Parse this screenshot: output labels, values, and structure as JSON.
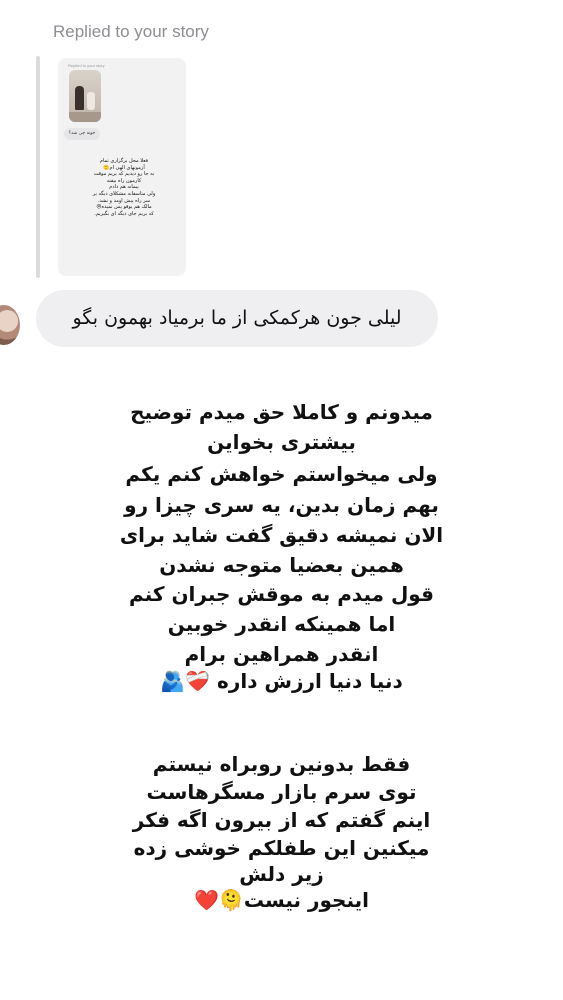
{
  "reply_header": {
    "label": "Replied to your story"
  },
  "story_preview": {
    "mini_label": "Replied to your story",
    "mini_reply": "خونه چی شد؟",
    "mini_caption": "فعلا محل برگزاری تمام\nآزمونهای الهی ام🙂\nبه جا رو دیدیم که بریم موقت\nکارمون راه بیفته\nبیمانه هم دادم\nولی متاسفانه مشکلای دیگه بر\nسر راه پیش اومد و نشد.\nمالک هم یوقو پس نمیده😒\nکه بریم جای دیگه ای بگیریم."
  },
  "message": {
    "text": "لیلی جون هرکمکی از ما برمیاد بهمون بگو"
  },
  "caption": {
    "paragraph1": [
      "میدونم و کاملا حق میدم توضیح",
      "بیشتری بخواین",
      "ولی میخواستم خواهش کنم یکم",
      "بهم زمان بدین، یه سری چیزا رو",
      "الان نمیشه دقیق گفت شاید برای",
      "همین بعضیا متوجه نشدن",
      "قول میدم به موقش جبران کنم",
      "اما همینکه انقدر خوبین",
      "انقدر همراهین برام",
      "دنیا دنیا ارزش داره ❤️‍🩹🫂"
    ],
    "paragraph2": [
      "فقط بدونین روبراه نیستم",
      "توی سرم بازار مسگرهاست",
      "اینم گفتم که از بیرون اگه فکر",
      "میکنین این طفلکم خوشی زده",
      "زیر دلش",
      "اینجور نیست🫠❤️"
    ]
  }
}
